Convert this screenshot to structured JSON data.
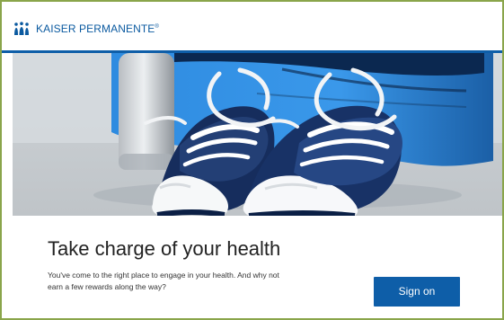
{
  "header": {
    "logo_text": "KAISER PERMANENTE",
    "logo_mark": "®",
    "logo_icon": "kaiser-permanente-logo-icon"
  },
  "hero": {
    "image": "sneakers-on-gym-bag-image"
  },
  "main": {
    "headline": "Take charge of your health",
    "body": "You've come to the right place to engage in your health. And why not earn a few rewards along the way?",
    "sign_on_label": "Sign on"
  },
  "colors": {
    "brand_blue": "#0e5ea8",
    "frame_green": "#8aa54b",
    "logo_blue": "#0b5aa0"
  }
}
